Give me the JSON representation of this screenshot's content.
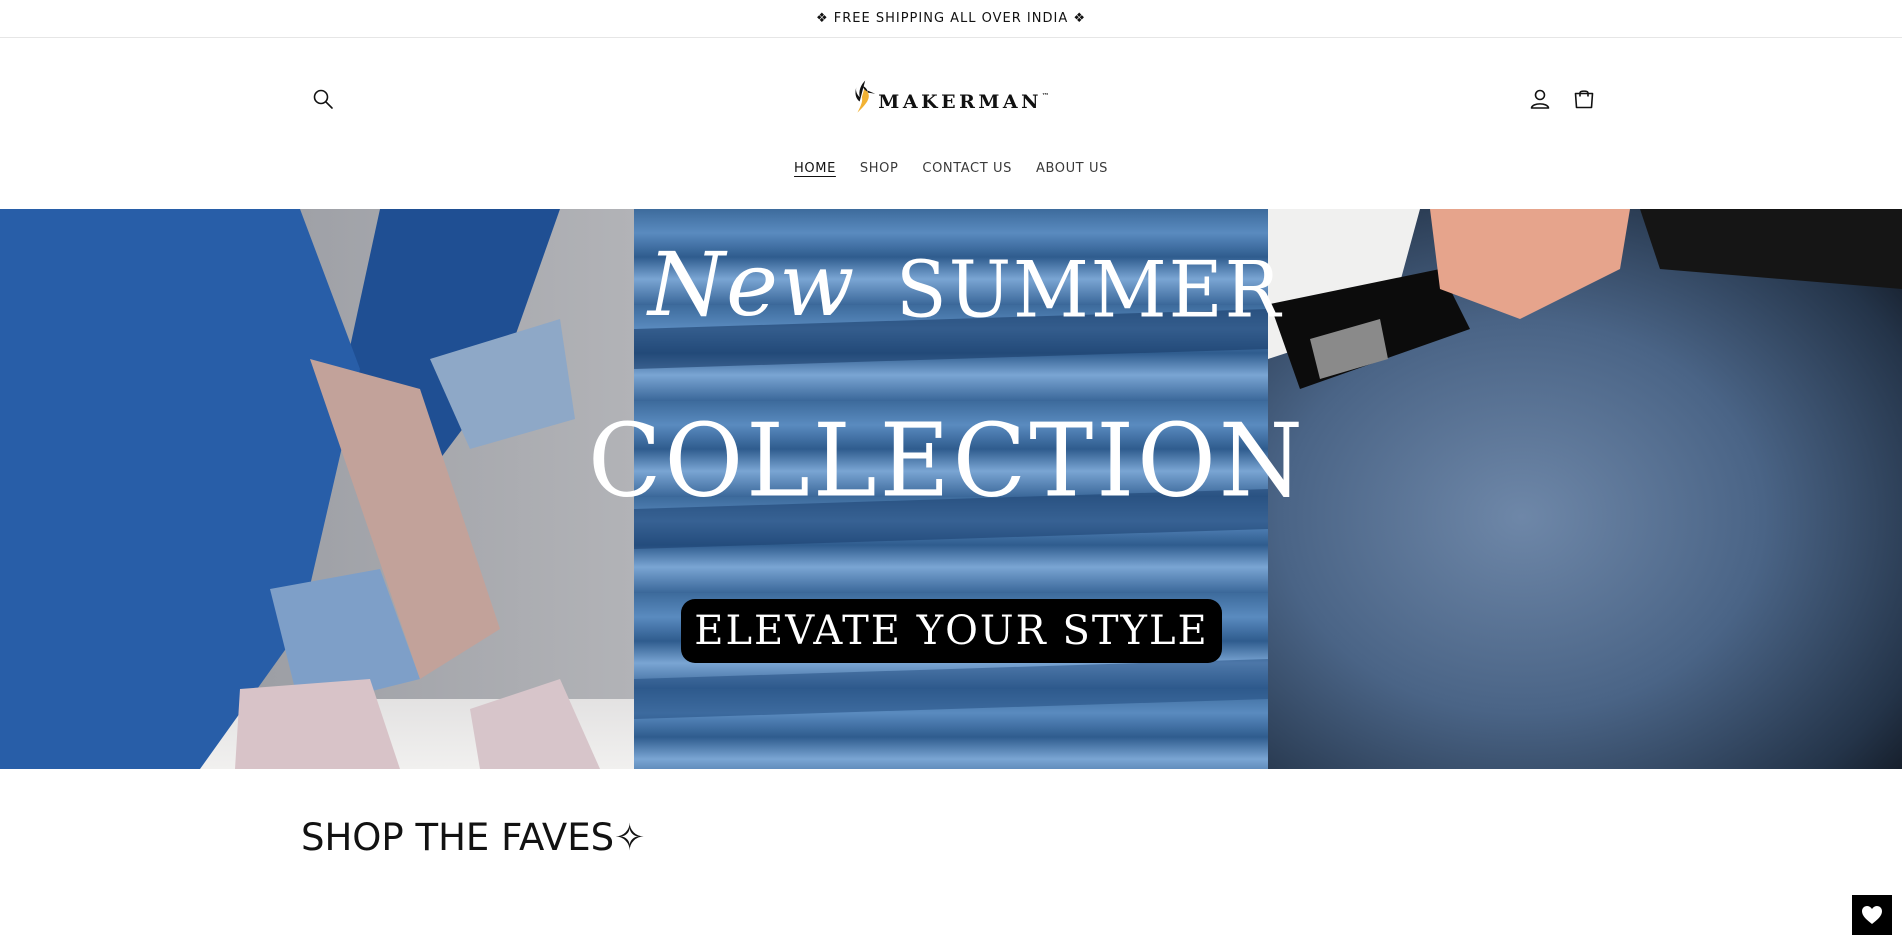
{
  "announcement": {
    "text": "❖ FREE SHIPPING ALL OVER INDIA ❖"
  },
  "header": {
    "logo_text": "MAKERMAN",
    "logo_tm": "™",
    "icons": {
      "search": "search-icon",
      "account": "account-icon",
      "cart": "cart-icon"
    }
  },
  "nav": {
    "items": [
      {
        "label": "HOME",
        "active": true
      },
      {
        "label": "SHOP",
        "active": false
      },
      {
        "label": "CONTACT US",
        "active": false
      },
      {
        "label": "ABOUT US",
        "active": false
      }
    ]
  },
  "hero": {
    "line1_script": "New",
    "line1_caps": "SUMMER",
    "line2": "COLLECTION",
    "badge": "ELEVATE YOUR STYLE"
  },
  "section": {
    "title": "SHOP THE FAVES✧"
  },
  "floating": {
    "wishlist_icon": "heart-icon"
  },
  "colors": {
    "accent": "#000000",
    "logo_yellow": "#f2b233",
    "announcement_border": "#e6e6e6"
  }
}
